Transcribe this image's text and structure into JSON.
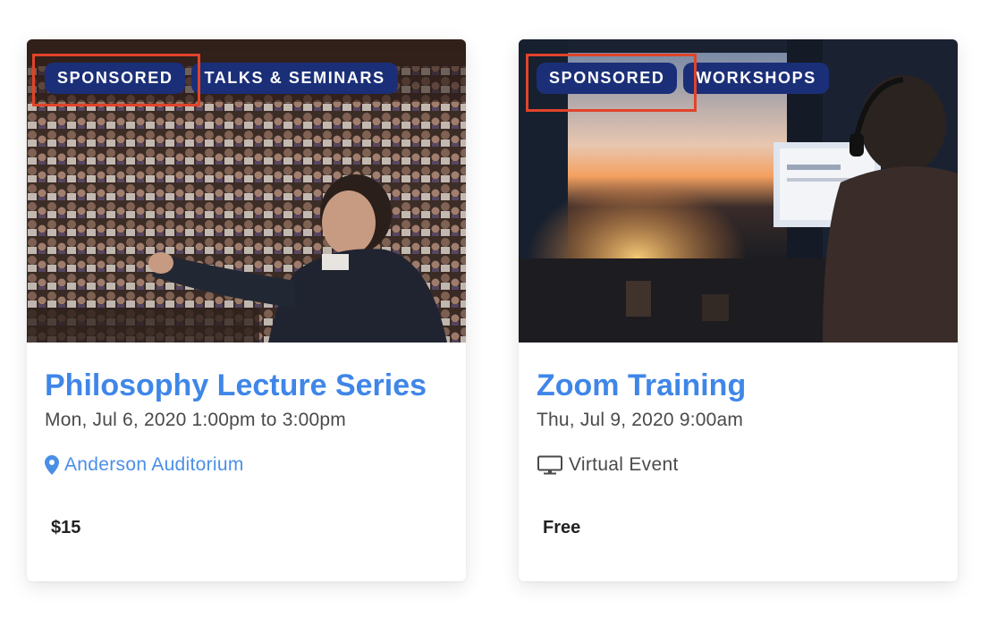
{
  "events": [
    {
      "tags": [
        "SPONSORED",
        "TALKS & SEMINARS"
      ],
      "title": "Philosophy Lecture Series",
      "datetime": "Mon, Jul 6, 2020 1:00pm to 3:00pm",
      "location_icon": "map-pin-icon",
      "location": "Anderson Auditorium",
      "price": "$15",
      "image": "lecture-hall-speaker-photo"
    },
    {
      "tags": [
        "SPONSORED",
        "WORKSHOPS"
      ],
      "title": "Zoom Training",
      "datetime": "Thu, Jul 9, 2020 9:00am",
      "location_icon": "monitor-icon",
      "location": "Virtual Event",
      "price": "Free",
      "image": "person-at-computer-sunset-photo"
    }
  ],
  "colors": {
    "tag_bg": "#1b2f78",
    "title": "#3f86e8",
    "location_link": "#4a8fe6",
    "highlight": "#e0442a"
  }
}
